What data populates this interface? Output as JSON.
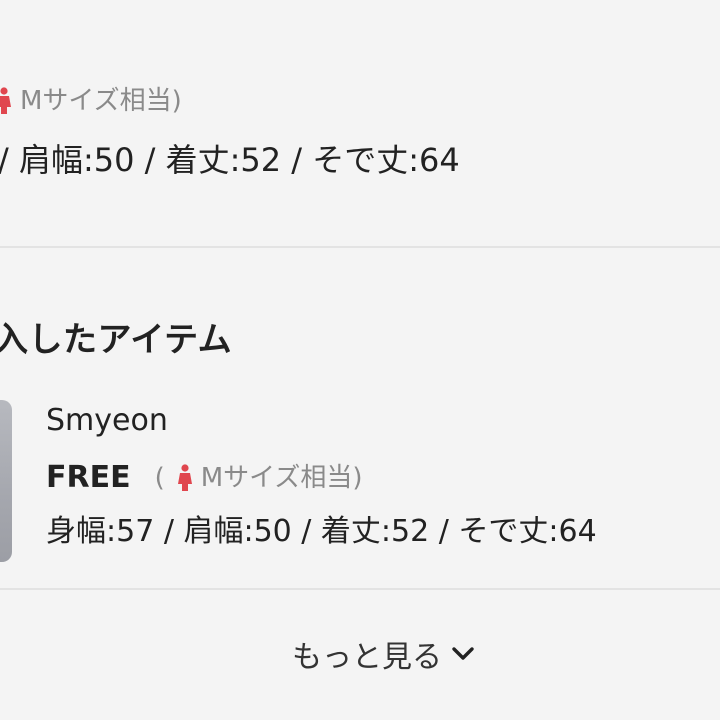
{
  "top_item": {
    "size_note_prefix": "(",
    "size_note": "Mサイズ相当)",
    "measurements": "/ 肩幅:50 / 着丈:52 / そで丈:64"
  },
  "section": {
    "title": "入したアイテム"
  },
  "item": {
    "name": "Smyeon",
    "size": "FREE",
    "size_note_prefix": "(",
    "size_note": "Mサイズ相当)",
    "measurements": "身幅:57 / 肩幅:50 / 着丈:52 / そで丈:64"
  },
  "more": {
    "label": "もっと見る"
  },
  "colors": {
    "person_icon": "#e0464e",
    "muted_text": "#8a8a8a",
    "divider": "#e3e3e3",
    "background": "#f4f4f4"
  },
  "icons": {
    "person": "person-icon",
    "chevron": "chevron-down-icon"
  }
}
